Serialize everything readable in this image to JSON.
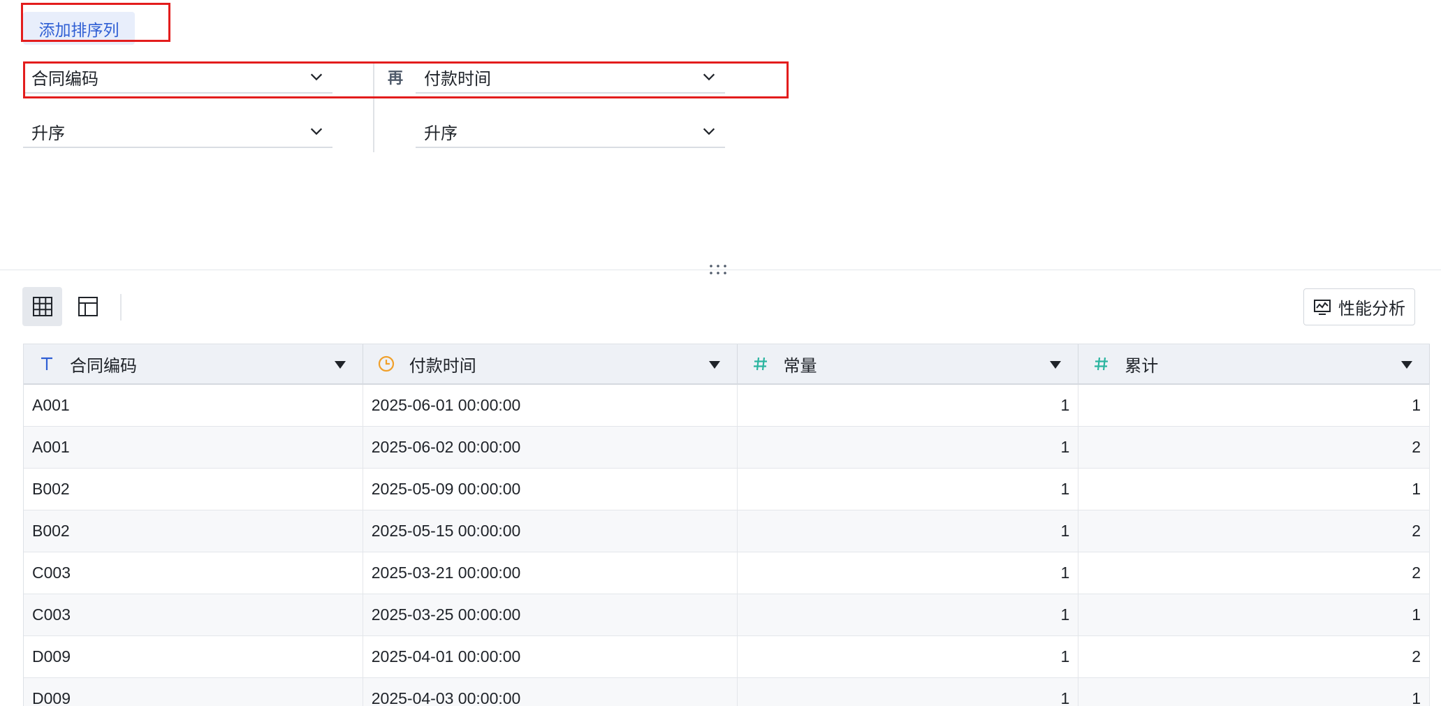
{
  "sort_panel": {
    "add_sort_label": "添加排序列",
    "then_label": "再",
    "primary": {
      "field": "合同编码",
      "order": "升序"
    },
    "secondary": {
      "field": "付款时间",
      "order": "升序"
    }
  },
  "toolbar": {
    "performance_label": "性能分析"
  },
  "table": {
    "columns": [
      {
        "label": "合同编码",
        "type": "text"
      },
      {
        "label": "付款时间",
        "type": "datetime"
      },
      {
        "label": "常量",
        "type": "number"
      },
      {
        "label": "累计",
        "type": "number"
      }
    ],
    "rows": [
      {
        "code": "A001",
        "time": "2025-06-01 00:00:00",
        "const": "1",
        "cum": "1"
      },
      {
        "code": "A001",
        "time": "2025-06-02 00:00:00",
        "const": "1",
        "cum": "2"
      },
      {
        "code": "B002",
        "time": "2025-05-09 00:00:00",
        "const": "1",
        "cum": "1"
      },
      {
        "code": "B002",
        "time": "2025-05-15 00:00:00",
        "const": "1",
        "cum": "2"
      },
      {
        "code": "C003",
        "time": "2025-03-21 00:00:00",
        "const": "1",
        "cum": "2"
      },
      {
        "code": "C003",
        "time": "2025-03-25 00:00:00",
        "const": "1",
        "cum": "1"
      },
      {
        "code": "D009",
        "time": "2025-04-01 00:00:00",
        "const": "1",
        "cum": "2"
      },
      {
        "code": "D009",
        "time": "2025-04-03 00:00:00",
        "const": "1",
        "cum": "1"
      }
    ]
  },
  "colors": {
    "highlight": "#e31d1d",
    "link_blue": "#2f5fd4",
    "text_type_icon": "#2f5fd4",
    "date_type_icon": "#f0a02a",
    "number_type_icon": "#2bb5a0"
  }
}
